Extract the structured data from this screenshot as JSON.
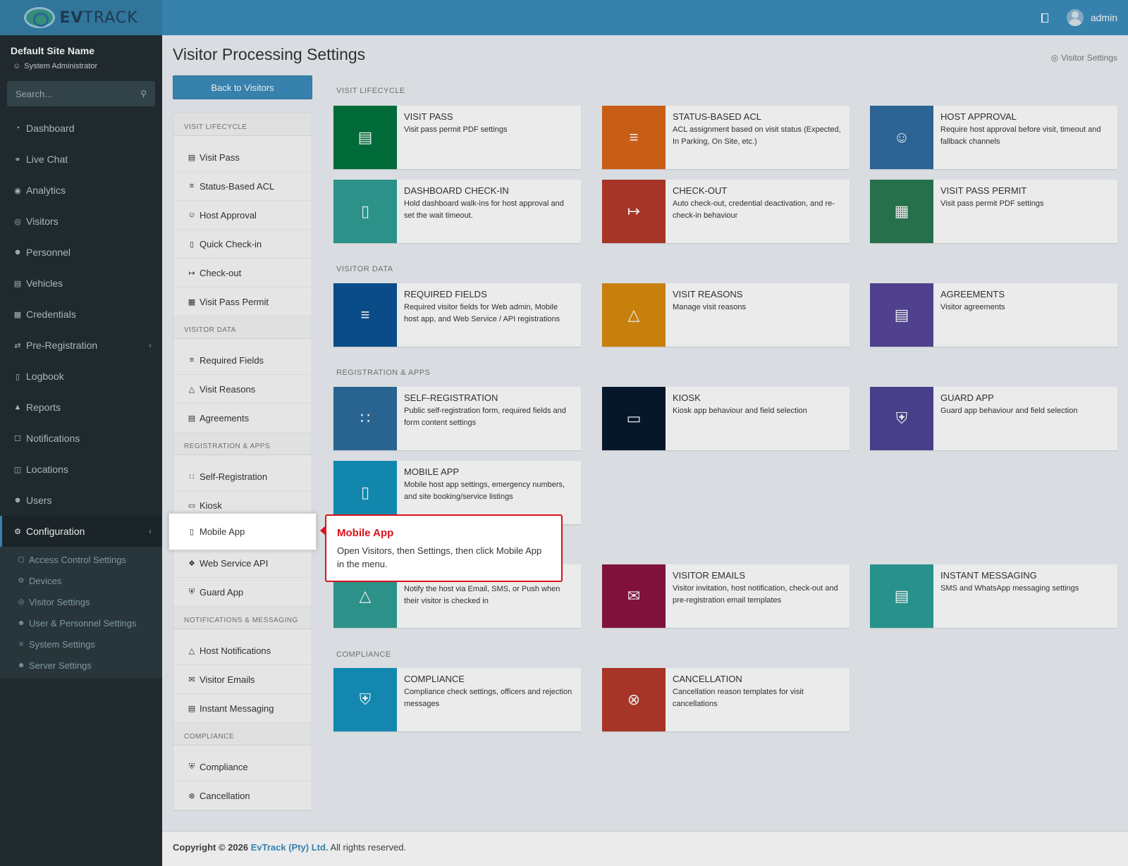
{
  "topbar": {
    "logo_ev": "EV",
    "logo_track": "TRACK",
    "username": "admin"
  },
  "sidebar": {
    "site_name": "Default Site Name",
    "role": "System Administrator",
    "search_placeholder": "Search...",
    "items": [
      {
        "label": "Dashboard",
        "icon": "dashboard-icon"
      },
      {
        "label": "Live Chat",
        "icon": "headset-icon"
      },
      {
        "label": "Analytics",
        "icon": "target-icon"
      },
      {
        "label": "Visitors",
        "icon": "eye-icon"
      },
      {
        "label": "Personnel",
        "icon": "user-tie-icon"
      },
      {
        "label": "Vehicles",
        "icon": "car-icon"
      },
      {
        "label": "Credentials",
        "icon": "id-card-icon"
      },
      {
        "label": "Pre-Registration",
        "icon": "exchange-icon"
      },
      {
        "label": "Logbook",
        "icon": "book-icon"
      },
      {
        "label": "Reports",
        "icon": "chart-icon"
      },
      {
        "label": "Notifications",
        "icon": "comments-icon"
      },
      {
        "label": "Locations",
        "icon": "map-icon"
      },
      {
        "label": "Users",
        "icon": "users-icon"
      },
      {
        "label": "Configuration",
        "icon": "gear-icon"
      }
    ],
    "sub_items": [
      {
        "label": "Access Control Settings",
        "icon": "lock-icon"
      },
      {
        "label": "Devices",
        "icon": "devices-icon"
      },
      {
        "label": "Visitor Settings",
        "icon": "eye-icon"
      },
      {
        "label": "User & Personnel Settings",
        "icon": "users-cog-icon"
      },
      {
        "label": "System Settings",
        "icon": "sliders-icon"
      },
      {
        "label": "Server Settings",
        "icon": "server-icon"
      }
    ]
  },
  "main": {
    "title": "Visitor Processing Settings",
    "breadcrumb": "Visitor Settings",
    "back_button": "Back to Visitors"
  },
  "subpanel": {
    "sections": [
      {
        "heading": "VISIT LIFECYCLE",
        "items": [
          "Visit Pass",
          "Status-Based ACL",
          "Host Approval",
          "Quick Check-in",
          "Check-out",
          "Visit Pass Permit"
        ]
      },
      {
        "heading": "VISITOR DATA",
        "items": [
          "Required Fields",
          "Visit Reasons",
          "Agreements"
        ]
      },
      {
        "heading": "REGISTRATION & APPS",
        "items": [
          "Self-Registration",
          "Kiosk",
          "Mobile App",
          "Web Service API",
          "Guard App"
        ]
      },
      {
        "heading": "NOTIFICATIONS & MESSAGING",
        "items": [
          "Host Notifications",
          "Visitor Emails",
          "Instant Messaging"
        ]
      },
      {
        "heading": "COMPLIANCE",
        "items": [
          "Compliance",
          "Cancellation"
        ]
      }
    ]
  },
  "grid": {
    "sections": {
      "visit_lifecycle": "VISIT LIFECYCLE",
      "visitor_data": "VISITOR DATA",
      "registration_apps": "REGISTRATION & APPS",
      "compliance": "COMPLIANCE"
    },
    "cards": {
      "visit_pass": {
        "title": "VISIT PASS",
        "desc": "Visit pass permit PDF settings",
        "color": "#00733e"
      },
      "status_acl": {
        "title": "STATUS-BASED ACL",
        "desc": "ACL assignment based on visit status (Expected, In Parking, On Site, etc.)",
        "color": "#d9651a"
      },
      "host_approval": {
        "title": "HOST APPROVAL",
        "desc": "Require host approval before visit, timeout and fallback channels",
        "color": "#2f6da0"
      },
      "dashboard_checkin": {
        "title": "DASHBOARD CHECK-IN",
        "desc": "Hold dashboard walk-ins for host approval and set the wait timeout.",
        "color": "#2f9e95"
      },
      "checkout": {
        "title": "CHECK-OUT",
        "desc": "Auto check-out, credential deactivation, and re-check-in behaviour",
        "color": "#b5392b"
      },
      "visit_pass_permit": {
        "title": "VISIT PASS PERMIT",
        "desc": "Visit pass permit PDF settings",
        "color": "#2b7a53"
      },
      "required_fields": {
        "title": "REQUIRED FIELDS",
        "desc": "Required visitor fields for Web admin, Mobile host app, and Web Service / API registrations",
        "color": "#0b5394"
      },
      "visit_reasons": {
        "title": "VISIT REASONS",
        "desc": "Manage visit reasons",
        "color": "#d98b0e"
      },
      "agreements": {
        "title": "AGREEMENTS",
        "desc": "Visitor agreements",
        "color": "#56479a"
      },
      "self_registration": {
        "title": "SELF-REGISTRATION",
        "desc": "Public self-registration form, required fields and form content settings",
        "color": "#2d6d9d"
      },
      "kiosk": {
        "title": "KIOSK",
        "desc": "Kiosk app behaviour and field selection",
        "color": "#071a2e"
      },
      "guard_app": {
        "title": "GUARD APP",
        "desc": "Guard app behaviour and field selection",
        "color": "#4f4596"
      },
      "mobile_app": {
        "title": "MOBILE APP",
        "desc": "Mobile host app settings, emergency numbers, and site booking/service listings",
        "color": "#1493bd"
      },
      "host_notifications": {
        "title": "",
        "desc": "Notify the host via Email, SMS, or Push when their visitor is checked in",
        "color": "#2f9e95"
      },
      "visitor_emails": {
        "title": "VISITOR EMAILS",
        "desc": "Visitor invitation, host notification, check-out and pre-registration email templates",
        "color": "#8b1340"
      },
      "instant_messaging": {
        "title": "INSTANT MESSAGING",
        "desc": "SMS and WhatsApp messaging settings",
        "color": "#2c9e98"
      },
      "compliance": {
        "title": "COMPLIANCE",
        "desc": "Compliance check settings, officers and rejection messages",
        "color": "#1593bf"
      },
      "cancellation": {
        "title": "CANCELLATION",
        "desc": "Cancellation reason templates for visit cancellations",
        "color": "#b5392b"
      }
    }
  },
  "tooltip": {
    "title": "Mobile App",
    "text": "Open Visitors, then Settings, then click Mobile App in the menu."
  },
  "footer": {
    "copyright": "Copyright © 2026",
    "company": "EvTrack (Pty) Ltd.",
    "rights": "All rights reserved."
  }
}
